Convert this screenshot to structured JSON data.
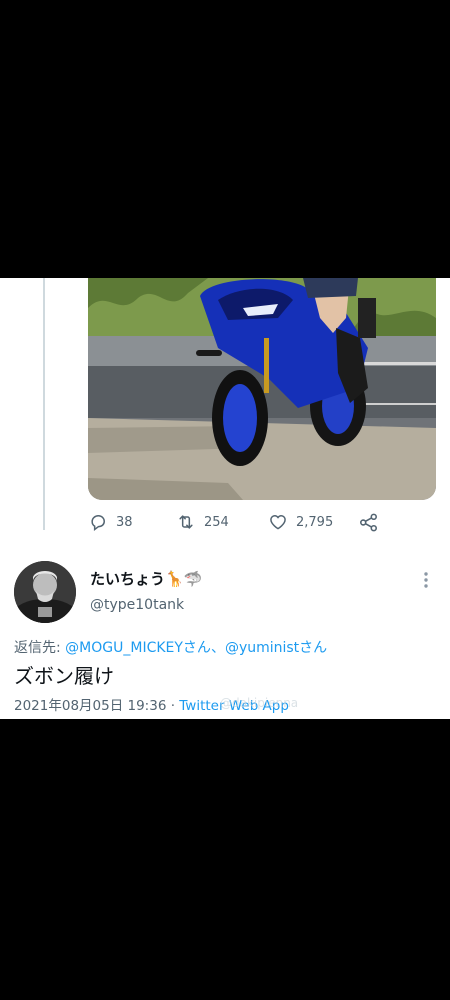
{
  "tweet_top": {
    "replies": "38",
    "retweets": "254",
    "likes": "2,795"
  },
  "reply_tweet": {
    "display_name": "たいちょう🦒🦈",
    "handle": "@type10tank",
    "reply_prefix": "返信先: ",
    "mention_1": "@MOGU_MICKEYさん",
    "separator": "、",
    "mention_2": "@yuministさん",
    "text": "ズボン履け",
    "timestamp": "2021年08月05日 19:36",
    "meta_separator": " · ",
    "source_app": "Twitter Web App",
    "watermark": "@dakipienna"
  },
  "icons": [
    "reply-icon",
    "retweet-icon",
    "like-icon",
    "share-icon",
    "more-icon"
  ],
  "colors": {
    "accent": "#1d9bf0",
    "secondary_text": "#536471",
    "motorcycle": "#1530b8"
  }
}
